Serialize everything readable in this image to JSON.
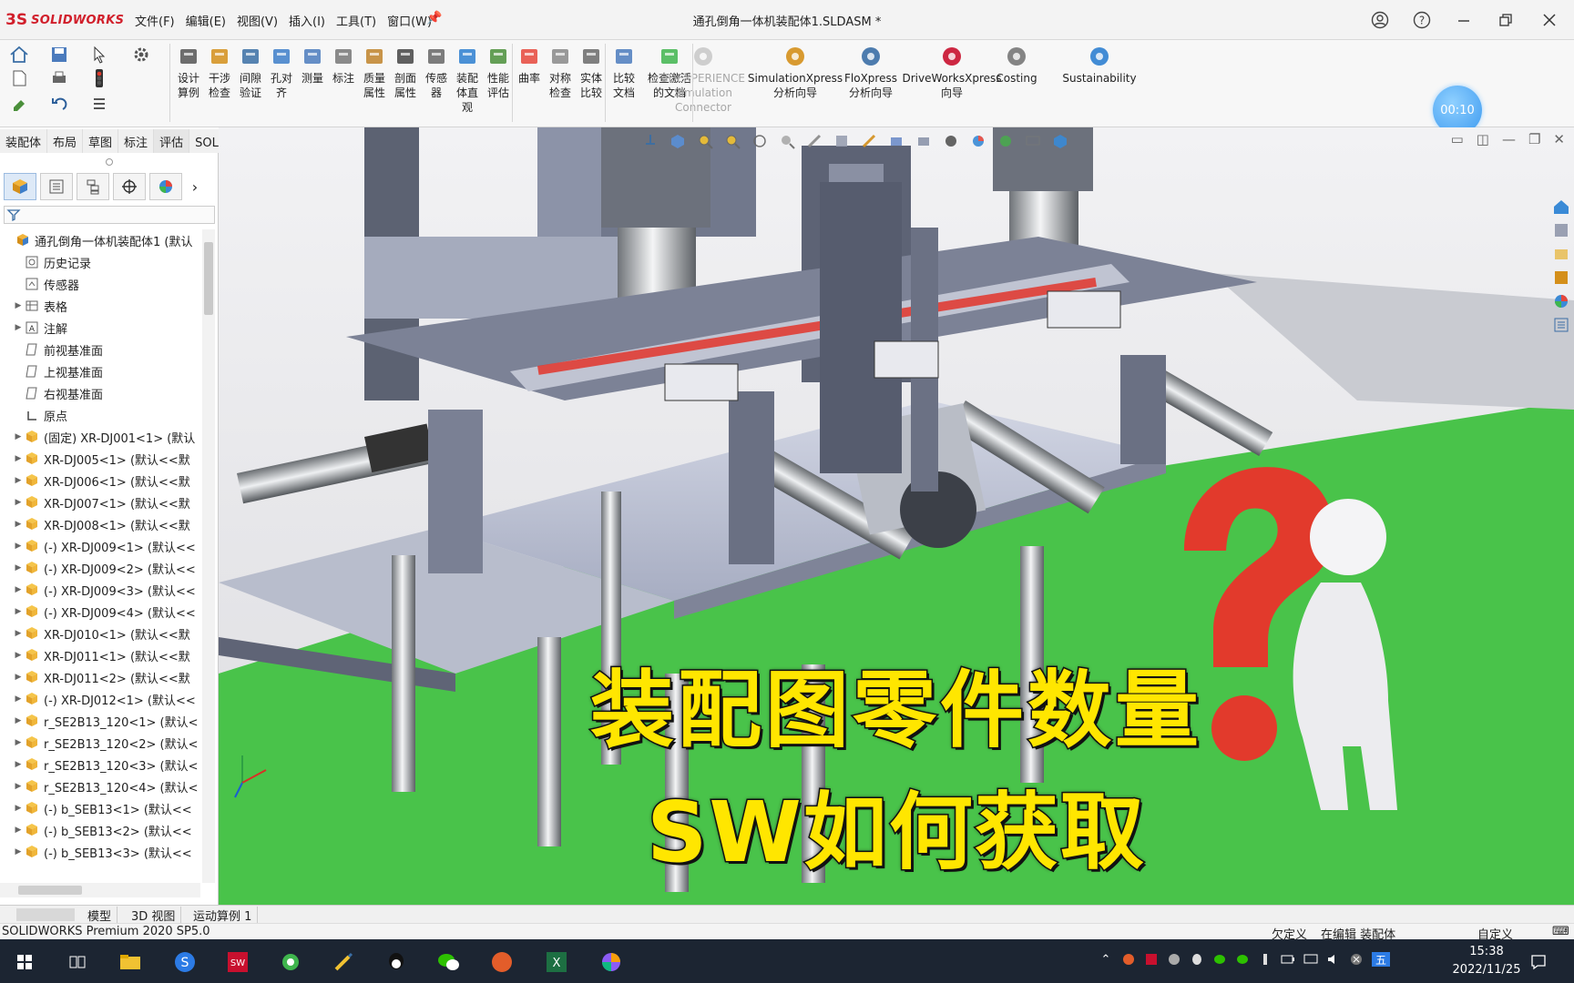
{
  "app": {
    "logo_text": "SOLIDWORKS",
    "document_title": "通孔倒角一体机装配体1.SLDASM *"
  },
  "menu": [
    "文件(F)",
    "编辑(E)",
    "视图(V)",
    "插入(I)",
    "工具(T)",
    "窗口(W)"
  ],
  "ribbon": {
    "timer": "00:10",
    "buttons": [
      {
        "label": "设计\n算例",
        "icon": "design-study-icon"
      },
      {
        "label": "干涉\n检查",
        "icon": "interference-check-icon"
      },
      {
        "label": "间隙\n验证",
        "icon": "clearance-verify-icon"
      },
      {
        "label": "孔对\n齐",
        "icon": "hole-align-icon"
      },
      {
        "label": "测量",
        "icon": "measure-icon"
      },
      {
        "label": "标注",
        "icon": "markup-icon"
      },
      {
        "label": "质量\n属性",
        "icon": "mass-properties-icon"
      },
      {
        "label": "剖面\n属性",
        "icon": "section-properties-icon"
      },
      {
        "label": "传感\n器",
        "icon": "sensor-icon"
      },
      {
        "label": "装配\n体直\n观",
        "icon": "assembly-visualization-icon"
      },
      {
        "label": "性能\n评估",
        "icon": "performance-eval-icon"
      },
      {
        "label": "曲率",
        "icon": "curvature-icon"
      },
      {
        "label": "对称\n检查",
        "icon": "symmetry-check-icon"
      },
      {
        "label": "实体\n比较",
        "icon": "body-compare-icon"
      },
      {
        "label": "比较\n文档",
        "icon": "compare-docs-icon"
      },
      {
        "label": "检查激活\n的文档",
        "icon": "check-active-doc-icon"
      }
    ],
    "wide_buttons": [
      {
        "label": "3DEXPERIENCE\nSimulation\nConnector",
        "icon": "3dx-connector-icon",
        "disabled": true
      },
      {
        "label": "SimulationXpress\n分析向导",
        "icon": "simulationxpress-icon",
        "disabled": false
      },
      {
        "label": "FloXpress\n分析向导",
        "icon": "floxpress-icon",
        "disabled": false
      },
      {
        "label": "DriveWorksXpress\n向导",
        "icon": "driveworks-icon",
        "disabled": false
      },
      {
        "label": "Costing",
        "icon": "costing-icon",
        "disabled": false
      },
      {
        "label": "Sustainability",
        "icon": "sustainability-icon",
        "disabled": false
      }
    ]
  },
  "command_tabs": [
    "装配体",
    "布局",
    "草图",
    "标注",
    "评估",
    "SOLIDWORKS 插件"
  ],
  "active_command_tab": "评估",
  "tree": [
    {
      "label": "通孔倒角一体机装配体1 (默认",
      "icon": "assembly",
      "exp": false,
      "indent": 0
    },
    {
      "label": "历史记录",
      "icon": "history",
      "exp": false,
      "indent": 1
    },
    {
      "label": "传感器",
      "icon": "sensor",
      "exp": false,
      "indent": 1
    },
    {
      "label": "表格",
      "icon": "table",
      "exp": true,
      "indent": 1
    },
    {
      "label": "注解",
      "icon": "annotation",
      "exp": true,
      "indent": 1
    },
    {
      "label": "前视基准面",
      "icon": "plane",
      "exp": false,
      "indent": 1
    },
    {
      "label": "上视基准面",
      "icon": "plane",
      "exp": false,
      "indent": 1
    },
    {
      "label": "右视基准面",
      "icon": "plane",
      "exp": false,
      "indent": 1
    },
    {
      "label": "原点",
      "icon": "origin",
      "exp": false,
      "indent": 1
    },
    {
      "label": "(固定) XR-DJ001<1> (默认",
      "icon": "part",
      "exp": true,
      "indent": 1
    },
    {
      "label": "XR-DJ005<1> (默认<<默",
      "icon": "part",
      "exp": true,
      "indent": 1
    },
    {
      "label": "XR-DJ006<1> (默认<<默",
      "icon": "part",
      "exp": true,
      "indent": 1
    },
    {
      "label": "XR-DJ007<1> (默认<<默",
      "icon": "part",
      "exp": true,
      "indent": 1
    },
    {
      "label": "XR-DJ008<1> (默认<<默",
      "icon": "part",
      "exp": true,
      "indent": 1
    },
    {
      "label": "(-) XR-DJ009<1> (默认<<",
      "icon": "part",
      "exp": true,
      "indent": 1
    },
    {
      "label": "(-) XR-DJ009<2> (默认<<",
      "icon": "part",
      "exp": true,
      "indent": 1
    },
    {
      "label": "(-) XR-DJ009<3> (默认<<",
      "icon": "part",
      "exp": true,
      "indent": 1
    },
    {
      "label": "(-) XR-DJ009<4> (默认<<",
      "icon": "part",
      "exp": true,
      "indent": 1
    },
    {
      "label": "XR-DJ010<1> (默认<<默",
      "icon": "part",
      "exp": true,
      "indent": 1
    },
    {
      "label": "XR-DJ011<1> (默认<<默",
      "icon": "part",
      "exp": true,
      "indent": 1
    },
    {
      "label": "XR-DJ011<2> (默认<<默",
      "icon": "part",
      "exp": true,
      "indent": 1
    },
    {
      "label": "(-) XR-DJ012<1> (默认<<",
      "icon": "part",
      "exp": true,
      "indent": 1
    },
    {
      "label": "r_SE2B13_120<1> (默认<",
      "icon": "part",
      "exp": true,
      "indent": 1
    },
    {
      "label": "r_SE2B13_120<2> (默认<",
      "icon": "part",
      "exp": true,
      "indent": 1
    },
    {
      "label": "r_SE2B13_120<3> (默认<",
      "icon": "part",
      "exp": true,
      "indent": 1
    },
    {
      "label": "r_SE2B13_120<4> (默认<",
      "icon": "part",
      "exp": true,
      "indent": 1
    },
    {
      "label": "(-) b_SEB13<1> (默认<<",
      "icon": "part",
      "exp": true,
      "indent": 1
    },
    {
      "label": "(-) b_SEB13<2> (默认<<",
      "icon": "part",
      "exp": true,
      "indent": 1
    },
    {
      "label": "(-) b_SEB13<3> (默认<<",
      "icon": "part",
      "exp": true,
      "indent": 1
    }
  ],
  "viewport": {
    "caption_line1": "装配图零件数量",
    "caption_line2": "SW如何获取",
    "colors": {
      "floor": "#49c34a",
      "caption": "#ffe600",
      "question_mark": "#e23a2c"
    }
  },
  "bottom_tabs": [
    "模型",
    "3D 视图",
    "运动算例 1"
  ],
  "status": {
    "product": "SOLIDWORKS Premium 2020 SP5.0",
    "state": "欠定义",
    "editing": "在编辑 装配体",
    "custom": "自定义"
  },
  "taskbar": {
    "time": "15:38",
    "date": "2022/11/25",
    "ime": "五"
  }
}
